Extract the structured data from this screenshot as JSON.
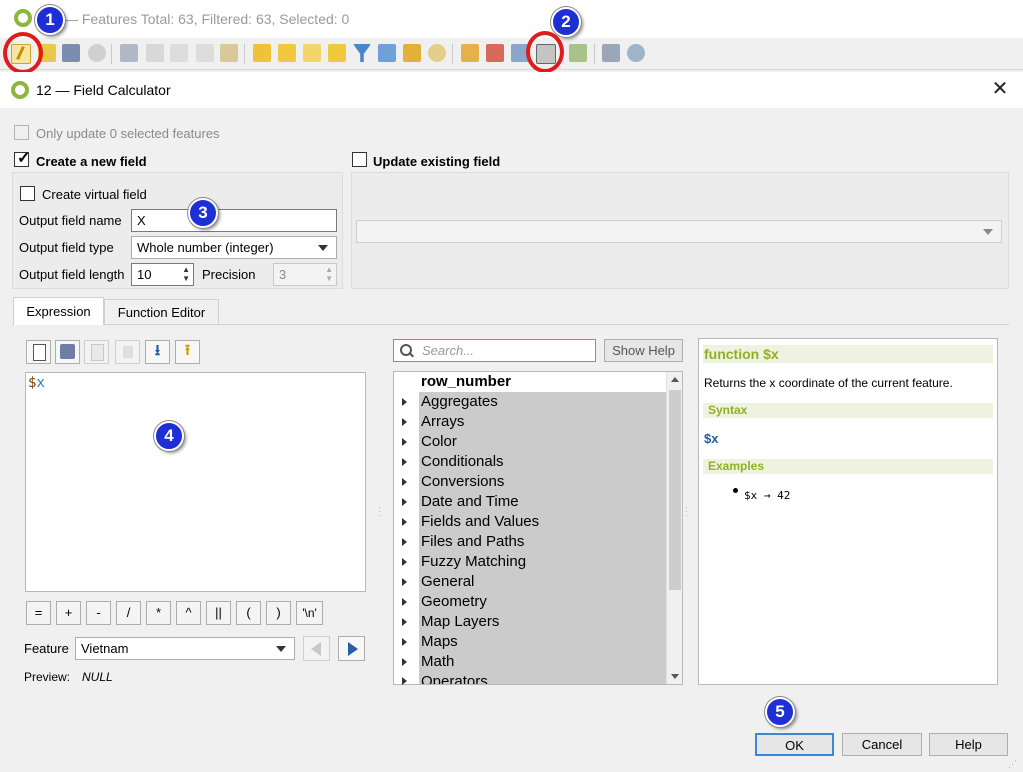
{
  "attribute_table": {
    "status": "— Features Total: 63, Filtered: 63, Selected: 0"
  },
  "dialog": {
    "title": "12 — Field Calculator",
    "only_update_label": "Only update 0 selected features",
    "create_new_field_label": "Create a new field",
    "update_existing_label": "Update existing field",
    "create_virtual_label": "Create virtual field",
    "output_name_label": "Output field name",
    "output_name_value": "X",
    "output_type_label": "Output field type",
    "output_type_value": "Whole number (integer)",
    "output_length_label": "Output field length",
    "output_length_value": "10",
    "precision_label": "Precision",
    "precision_value": "3"
  },
  "tabs": [
    "Expression",
    "Function Editor"
  ],
  "expression": {
    "text_prefix": "$",
    "text_var": "x"
  },
  "operators": [
    "=",
    "+",
    "-",
    "/",
    "*",
    "^",
    "||",
    "(",
    ")",
    "'\\n'"
  ],
  "feature": {
    "label": "Feature",
    "value": "Vietnam",
    "preview_label": "Preview:",
    "preview_value": "NULL"
  },
  "function_list": {
    "search_placeholder": "Search...",
    "show_help_label": "Show Help",
    "items": [
      "row_number",
      "Aggregates",
      "Arrays",
      "Color",
      "Conditionals",
      "Conversions",
      "Date and Time",
      "Fields and Values",
      "Files and Paths",
      "Fuzzy Matching",
      "General",
      "Geometry",
      "Map Layers",
      "Maps",
      "Math",
      "Operators"
    ]
  },
  "help": {
    "title": "function $x",
    "description": "Returns the x coordinate of the current feature.",
    "syntax_header": "Syntax",
    "syntax": "$x",
    "examples_header": "Examples",
    "example": "$x → 42"
  },
  "buttons": {
    "ok": "OK",
    "cancel": "Cancel",
    "help": "Help"
  },
  "annotations": [
    "1",
    "2",
    "3",
    "4",
    "5"
  ],
  "colors": {
    "badge_blue": "#1f2fd6",
    "ring_red": "#e01b1b",
    "help_green": "#93b023",
    "syntax_blue": "#1f5fa6"
  }
}
